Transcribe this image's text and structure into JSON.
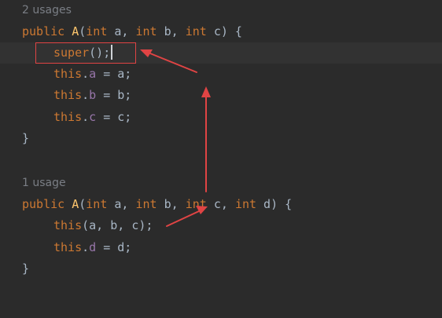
{
  "editor": {
    "block1": {
      "usage_hint": "2 usages",
      "sig": {
        "public": "public",
        "name": "A",
        "open": "(",
        "int1": "int",
        "p1": " a, ",
        "int2": "int",
        "p2": " b, ",
        "int3": "int",
        "p3": " c) {"
      },
      "super_kw": "super",
      "super_rest": "();",
      "lines": [
        {
          "this": "this",
          "dot": ".",
          "field": "a",
          "rest": " = a;"
        },
        {
          "this": "this",
          "dot": ".",
          "field": "b",
          "rest": " = b;"
        },
        {
          "this": "this",
          "dot": ".",
          "field": "c",
          "rest": " = c;"
        }
      ],
      "close": "}"
    },
    "block2": {
      "usage_hint": "1 usage",
      "sig": {
        "public": "public",
        "name": "A",
        "open": "(",
        "int1": "int",
        "p1": " a, ",
        "int2": "int",
        "p2": " b, ",
        "int3": "int",
        "p3": " c, ",
        "int4": "int",
        "p4": " d) {"
      },
      "this_call_kw": "this",
      "this_call_args": "(a, b, c);",
      "line": {
        "this": "this",
        "dot": ".",
        "field": "d",
        "rest": " = d;"
      },
      "close": "}"
    },
    "annotation_color": "#e04444"
  }
}
